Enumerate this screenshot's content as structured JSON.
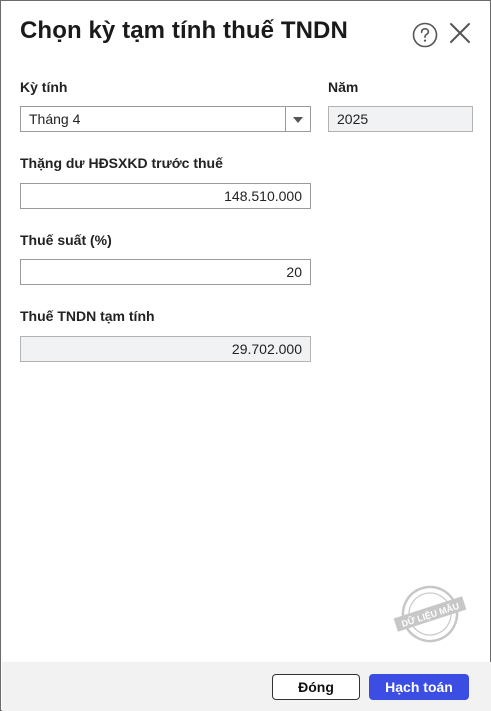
{
  "dialog": {
    "title": "Chọn kỳ tạm tính thuế TNDN",
    "help_icon": "help-circle-icon",
    "close_icon": "close-icon"
  },
  "period": {
    "label": "Kỳ tính",
    "value": "Tháng 4",
    "dropdown_icon": "chevron-down-icon"
  },
  "year": {
    "label": "Năm",
    "value": "2025"
  },
  "surplus": {
    "label": "Thặng dư HĐSXKD trước thuế",
    "value": "148.510.000"
  },
  "tax_rate": {
    "label": "Thuế suất (%)",
    "value": "20"
  },
  "provisional_tax": {
    "label": "Thuế TNDN tạm tính",
    "value": "29.702.000"
  },
  "watermark": {
    "text": "DỮ LIỆU MẪU"
  },
  "footer": {
    "close_label": "Đóng",
    "post_label": "Hạch toán"
  },
  "colors": {
    "primary": "#3b4de3",
    "readonly_bg": "#f1f2f4",
    "footer_bg": "#f2f2f2"
  }
}
